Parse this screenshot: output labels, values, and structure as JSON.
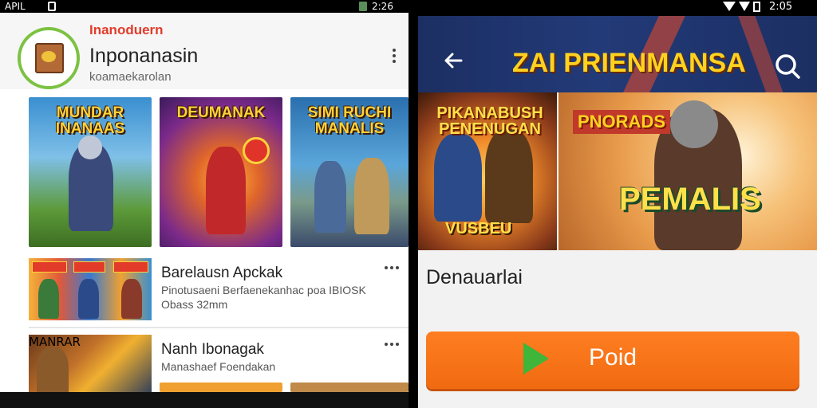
{
  "left_screen": {
    "status_bar": {
      "time_left": "APIL",
      "time_right": "2:26"
    },
    "header": {
      "brand_label": "Inanoduern",
      "app_title": "Inponanasin",
      "app_subtitle": "koamaekarolan",
      "logo_icon": "book-icon",
      "menu_icon": "more-vert-icon"
    },
    "featured_tiles": [
      {
        "title": "MUNDAR INANAAS"
      },
      {
        "title": "DEUMANAK"
      },
      {
        "title": "SIMI RUCHI MANALIS"
      }
    ],
    "list_items": [
      {
        "title": "Barelausn Apckak",
        "description": "Pinotusaeni Berfaenekanhac poa IBIOSK",
        "size": "Obass 32mm"
      },
      {
        "title": "Nanh Ibonagak",
        "description": "Manashaef Foendakan",
        "thumb_title": "MANRAR"
      }
    ]
  },
  "right_screen": {
    "status_bar": {
      "time": "2:05"
    },
    "banner": {
      "title": "ZAI PRIENMANSA"
    },
    "screenshots": [
      {
        "top_label": "PIKANABUSH PENENUGAN",
        "bottom_label": "VUSBEU"
      },
      {
        "top_label": "PNORADS",
        "main_label": "PEMALIS"
      }
    ],
    "section_title": "Denauarlai",
    "primary_button": {
      "label": "Poid",
      "icon": "play-icon"
    }
  }
}
